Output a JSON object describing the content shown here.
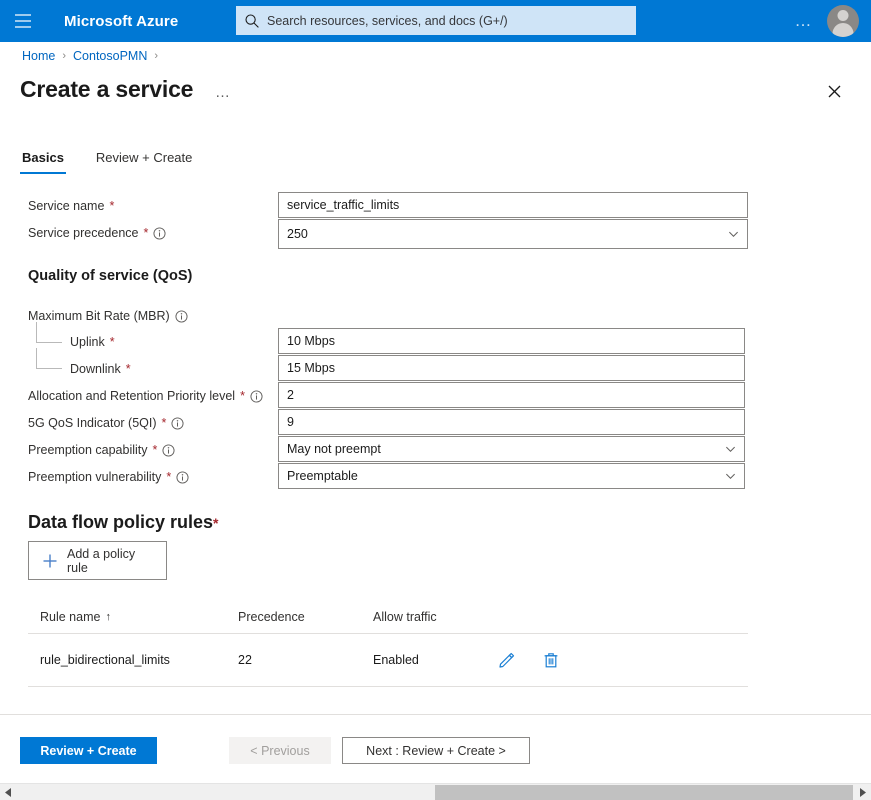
{
  "topbar": {
    "menu_icon": "hamburger-icon",
    "brand": "Microsoft Azure",
    "search_icon": "search-icon",
    "search_placeholder": "Search resources, services, and docs (G+/)",
    "search_value": "",
    "ellipsis": "…",
    "avatar_icon": "user-avatar-icon",
    "bg_color": "#0078d4"
  },
  "breadcrumb": {
    "items": [
      "Home",
      "ContosoPMN"
    ],
    "separator": "›",
    "trailing_separator": "›",
    "link_color": "#0066c0"
  },
  "header": {
    "title": "Create a service",
    "ellipsis": "…",
    "close_icon": "close-icon"
  },
  "tabs": [
    {
      "label": "Basics",
      "active": true
    },
    {
      "label": "Review + Create",
      "active": false
    }
  ],
  "basics": {
    "service_name": {
      "label": "Service name",
      "required": "*",
      "value": "service_traffic_limits",
      "placeholder": ""
    },
    "service_precedence": {
      "label": "Service precedence",
      "required": "*",
      "info_icon": "info-icon",
      "value": "250",
      "chevron_icon": "chevron-down-icon"
    }
  },
  "qos": {
    "heading": "Quality of service (QoS)",
    "mbr": {
      "label": "Maximum Bit Rate (MBR)",
      "info_icon": "info-icon",
      "uplink": {
        "label": "Uplink",
        "required": "*",
        "value": "10 Mbps"
      },
      "downlink": {
        "label": "Downlink",
        "required": "*",
        "value": "15 Mbps"
      }
    },
    "arp": {
      "label": "Allocation and Retention Priority level",
      "required": "*",
      "info_icon": "info-icon",
      "value": "2"
    },
    "fiveqi": {
      "label": "5G QoS Indicator (5QI)",
      "required": "*",
      "info_icon": "info-icon",
      "value": "9"
    },
    "preemption_capability": {
      "label": "Preemption capability",
      "required": "*",
      "info_icon": "info-icon",
      "value": "May not preempt",
      "chevron_icon": "chevron-down-icon"
    },
    "preemption_vulnerability": {
      "label": "Preemption vulnerability",
      "required": "*",
      "info_icon": "info-icon",
      "value": "Preemptable",
      "chevron_icon": "chevron-down-icon"
    }
  },
  "policy_rules": {
    "heading": "Data flow policy rules",
    "required": "*",
    "add_button": {
      "label": "Add a policy rule",
      "icon": "plus-icon"
    },
    "table": {
      "columns": [
        "Rule name",
        "Precedence",
        "Allow traffic"
      ],
      "sort_column": "Rule name",
      "sort_indicator": "↑",
      "rows": [
        {
          "rule_name": "rule_bidirectional_limits",
          "precedence": "22",
          "allow_traffic": "Enabled",
          "edit_icon": "edit-pencil-icon",
          "delete_icon": "delete-trash-icon"
        }
      ]
    }
  },
  "footer": {
    "review_create": "Review + Create",
    "previous": "< Previous",
    "next": "Next : Review + Create >",
    "primary_color": "#0078d4"
  },
  "scrollbar": {
    "left_arrow": "scroll-left-icon",
    "right_arrow": "scroll-right-icon"
  }
}
